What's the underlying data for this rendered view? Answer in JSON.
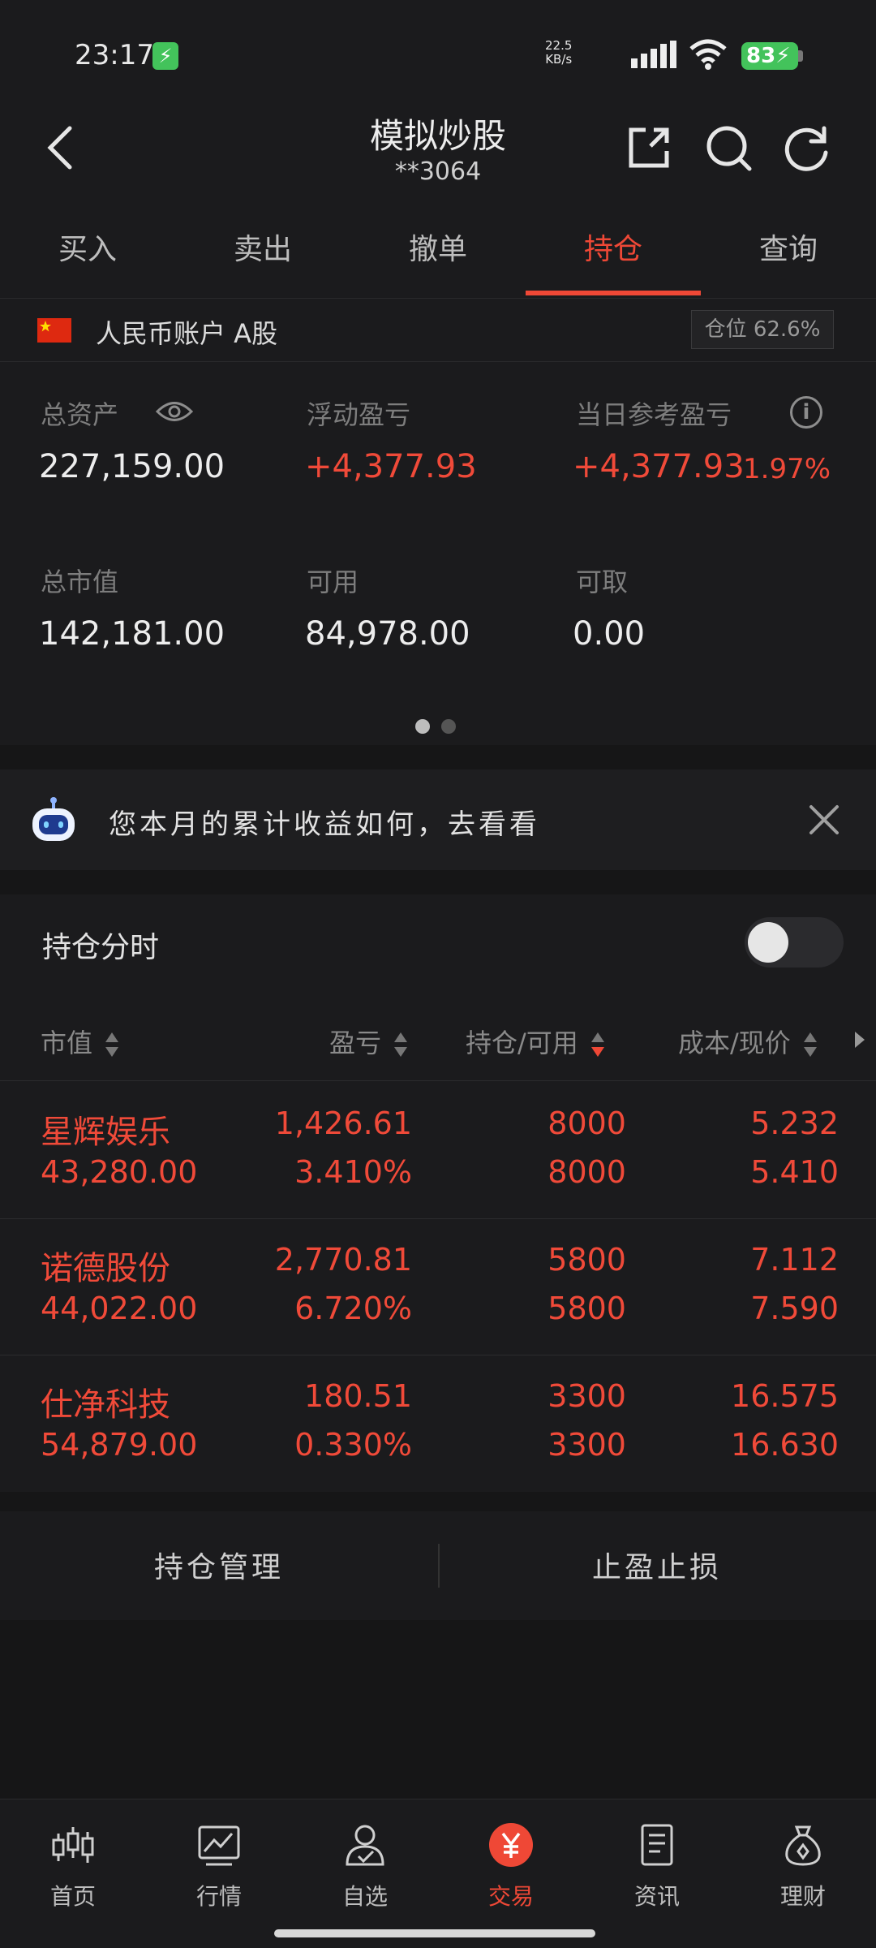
{
  "status_bar": {
    "time": "23:17",
    "charge_glyph": "⚡",
    "net_speed_value": "22.5",
    "net_speed_unit": "KB/s",
    "battery": "83"
  },
  "header": {
    "title": "模拟炒股",
    "account_masked": "**3064"
  },
  "tabs": [
    {
      "label": "买入"
    },
    {
      "label": "卖出"
    },
    {
      "label": "撤单"
    },
    {
      "label": "持仓",
      "active": true
    },
    {
      "label": "查询"
    }
  ],
  "account": {
    "name": "人民币账户 A股",
    "position_ratio": "仓位 62.6%",
    "metrics": {
      "total_assets_label": "总资产",
      "total_assets": "227,159.00",
      "floating_pl_label": "浮动盈亏",
      "floating_pl": "+4,377.93",
      "daily_pl_label": "当日参考盈亏",
      "daily_pl": "+4,377.93",
      "daily_pl_pct": "1.97%",
      "market_value_label": "总市值",
      "market_value": "142,181.00",
      "available_label": "可用",
      "available": "84,978.00",
      "withdrawable_label": "可取",
      "withdrawable": "0.00"
    }
  },
  "banner": {
    "text": "您本月的累计收益如何，去看看"
  },
  "holdings": {
    "title": "持仓分时",
    "columns": {
      "market_value": "市值",
      "pl": "盈亏",
      "qty": "持仓/可用",
      "cost": "成本/现价"
    },
    "rows": [
      {
        "name": "星辉娱乐",
        "market_value": "43,280.00",
        "pl": "1,426.61",
        "pl_pct": "3.410%",
        "hold": "8000",
        "avail": "8000",
        "cost": "5.232",
        "price": "5.410"
      },
      {
        "name": "诺德股份",
        "market_value": "44,022.00",
        "pl": "2,770.81",
        "pl_pct": "6.720%",
        "hold": "5800",
        "avail": "5800",
        "cost": "7.112",
        "price": "7.590"
      },
      {
        "name": "仕净科技",
        "market_value": "54,879.00",
        "pl": "180.51",
        "pl_pct": "0.330%",
        "hold": "3300",
        "avail": "3300",
        "cost": "16.575",
        "price": "16.630"
      }
    ]
  },
  "actions": {
    "manage": "持仓管理",
    "stop": "止盈止损"
  },
  "bottom_nav": [
    {
      "label": "首页",
      "icon": "candlestick-icon"
    },
    {
      "label": "行情",
      "icon": "chart-icon"
    },
    {
      "label": "自选",
      "icon": "person-check-icon"
    },
    {
      "label": "交易",
      "icon": "yen-icon",
      "active": true
    },
    {
      "label": "资讯",
      "icon": "document-icon"
    },
    {
      "label": "理财",
      "icon": "money-bag-icon"
    }
  ],
  "colors": {
    "accent_red": "#ef4836",
    "gain_red": "#f04a39",
    "background": "#161617",
    "panel": "#1b1b1d"
  }
}
